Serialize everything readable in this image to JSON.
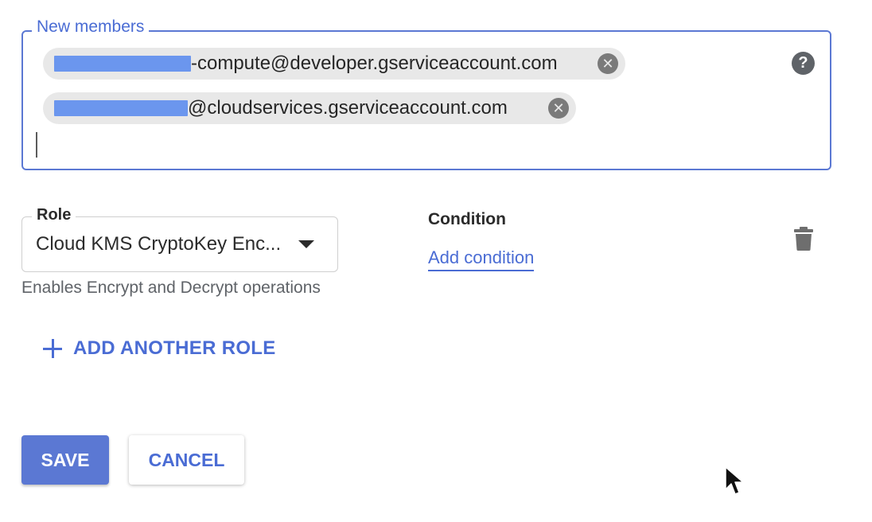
{
  "members": {
    "legend": "New members",
    "chips": [
      {
        "suffix": "-compute@developer.gserviceaccount.com",
        "remove_icon": "close-circle-icon"
      },
      {
        "suffix": "@cloudservices.gserviceaccount.com",
        "remove_icon": "close-circle-icon"
      }
    ],
    "help_icon": "help-circle-icon",
    "help_glyph": "?"
  },
  "role": {
    "legend": "Role",
    "value": "Cloud KMS CryptoKey Enc...",
    "helper": "Enables Encrypt and Decrypt operations",
    "dropdown_icon": "arrow-drop-down-icon"
  },
  "condition": {
    "label": "Condition",
    "link": "Add condition"
  },
  "delete_icon": "trash-icon",
  "add_role": {
    "label": "ADD ANOTHER ROLE",
    "icon": "plus-icon"
  },
  "actions": {
    "save": "SAVE",
    "cancel": "CANCEL"
  },
  "chip_remove_glyph": "✕",
  "colors": {
    "accent": "#4a6cd4",
    "primary_button": "#5b78d3",
    "redaction": "#6b96ee",
    "chip_bg": "#e8e8e8"
  }
}
